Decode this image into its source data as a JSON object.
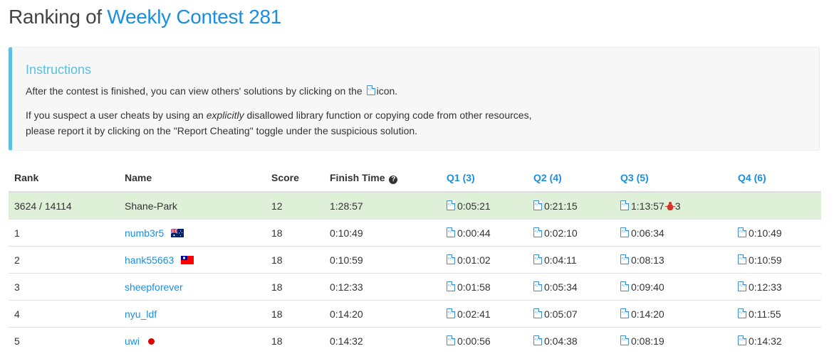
{
  "header": {
    "prefix": "Ranking of",
    "contest_name": "Weekly Contest 281"
  },
  "instructions": {
    "title": "Instructions",
    "line1_before": "After the contest is finished, you can view others' solutions by clicking on the",
    "line1_after": "icon.",
    "line2_before": "If you suspect a user cheats by using an",
    "line2_em": "explicitly",
    "line2_after": "disallowed library function or copying code from other resources,",
    "line3": "please report it by clicking on the \"Report Cheating\" toggle under the suspicious solution."
  },
  "table": {
    "headers": {
      "rank": "Rank",
      "name": "Name",
      "score": "Score",
      "finish_time": "Finish Time",
      "q1": "Q1 (3)",
      "q2": "Q2 (4)",
      "q3": "Q3 (5)",
      "q4": "Q4 (6)"
    },
    "current_user": {
      "rank": "3624 / 14114",
      "name": "Shane-Park",
      "score": "12",
      "finish_time": "1:28:57",
      "q1": "0:05:21",
      "q2": "0:21:15",
      "q3": "1:13:57",
      "q3_wrong_attempts": "3",
      "q4": ""
    },
    "rows": [
      {
        "rank": "1",
        "name": "numb3r5",
        "flag": "australia-flag",
        "score": "18",
        "finish_time": "0:10:49",
        "q1": "0:00:44",
        "q2": "0:02:10",
        "q3": "0:06:34",
        "q4": "0:10:49"
      },
      {
        "rank": "2",
        "name": "hank55663",
        "flag": "taiwan-flag",
        "score": "18",
        "finish_time": "0:10:59",
        "q1": "0:01:02",
        "q2": "0:04:11",
        "q3": "0:08:13",
        "q4": "0:10:59"
      },
      {
        "rank": "3",
        "name": "sheepforever",
        "flag": "",
        "score": "18",
        "finish_time": "0:12:33",
        "q1": "0:01:58",
        "q2": "0:05:34",
        "q3": "0:09:40",
        "q4": "0:12:33"
      },
      {
        "rank": "4",
        "name": "nyu_ldf",
        "flag": "",
        "score": "18",
        "finish_time": "0:14:20",
        "q1": "0:02:41",
        "q2": "0:05:07",
        "q3": "0:14:20",
        "q4": "0:11:55"
      },
      {
        "rank": "5",
        "name": "uwi",
        "flag": "japan-flag",
        "score": "18",
        "finish_time": "0:14:32",
        "q1": "0:00:56",
        "q2": "0:04:38",
        "q3": "0:08:19",
        "q4": "0:14:32"
      }
    ]
  },
  "colors": {
    "link_blue": "#1a8ee0",
    "instructions_accent": "#5bc0de",
    "current_user_row": "#dff0d8",
    "wrong_attempt_red": "#d9322a"
  }
}
